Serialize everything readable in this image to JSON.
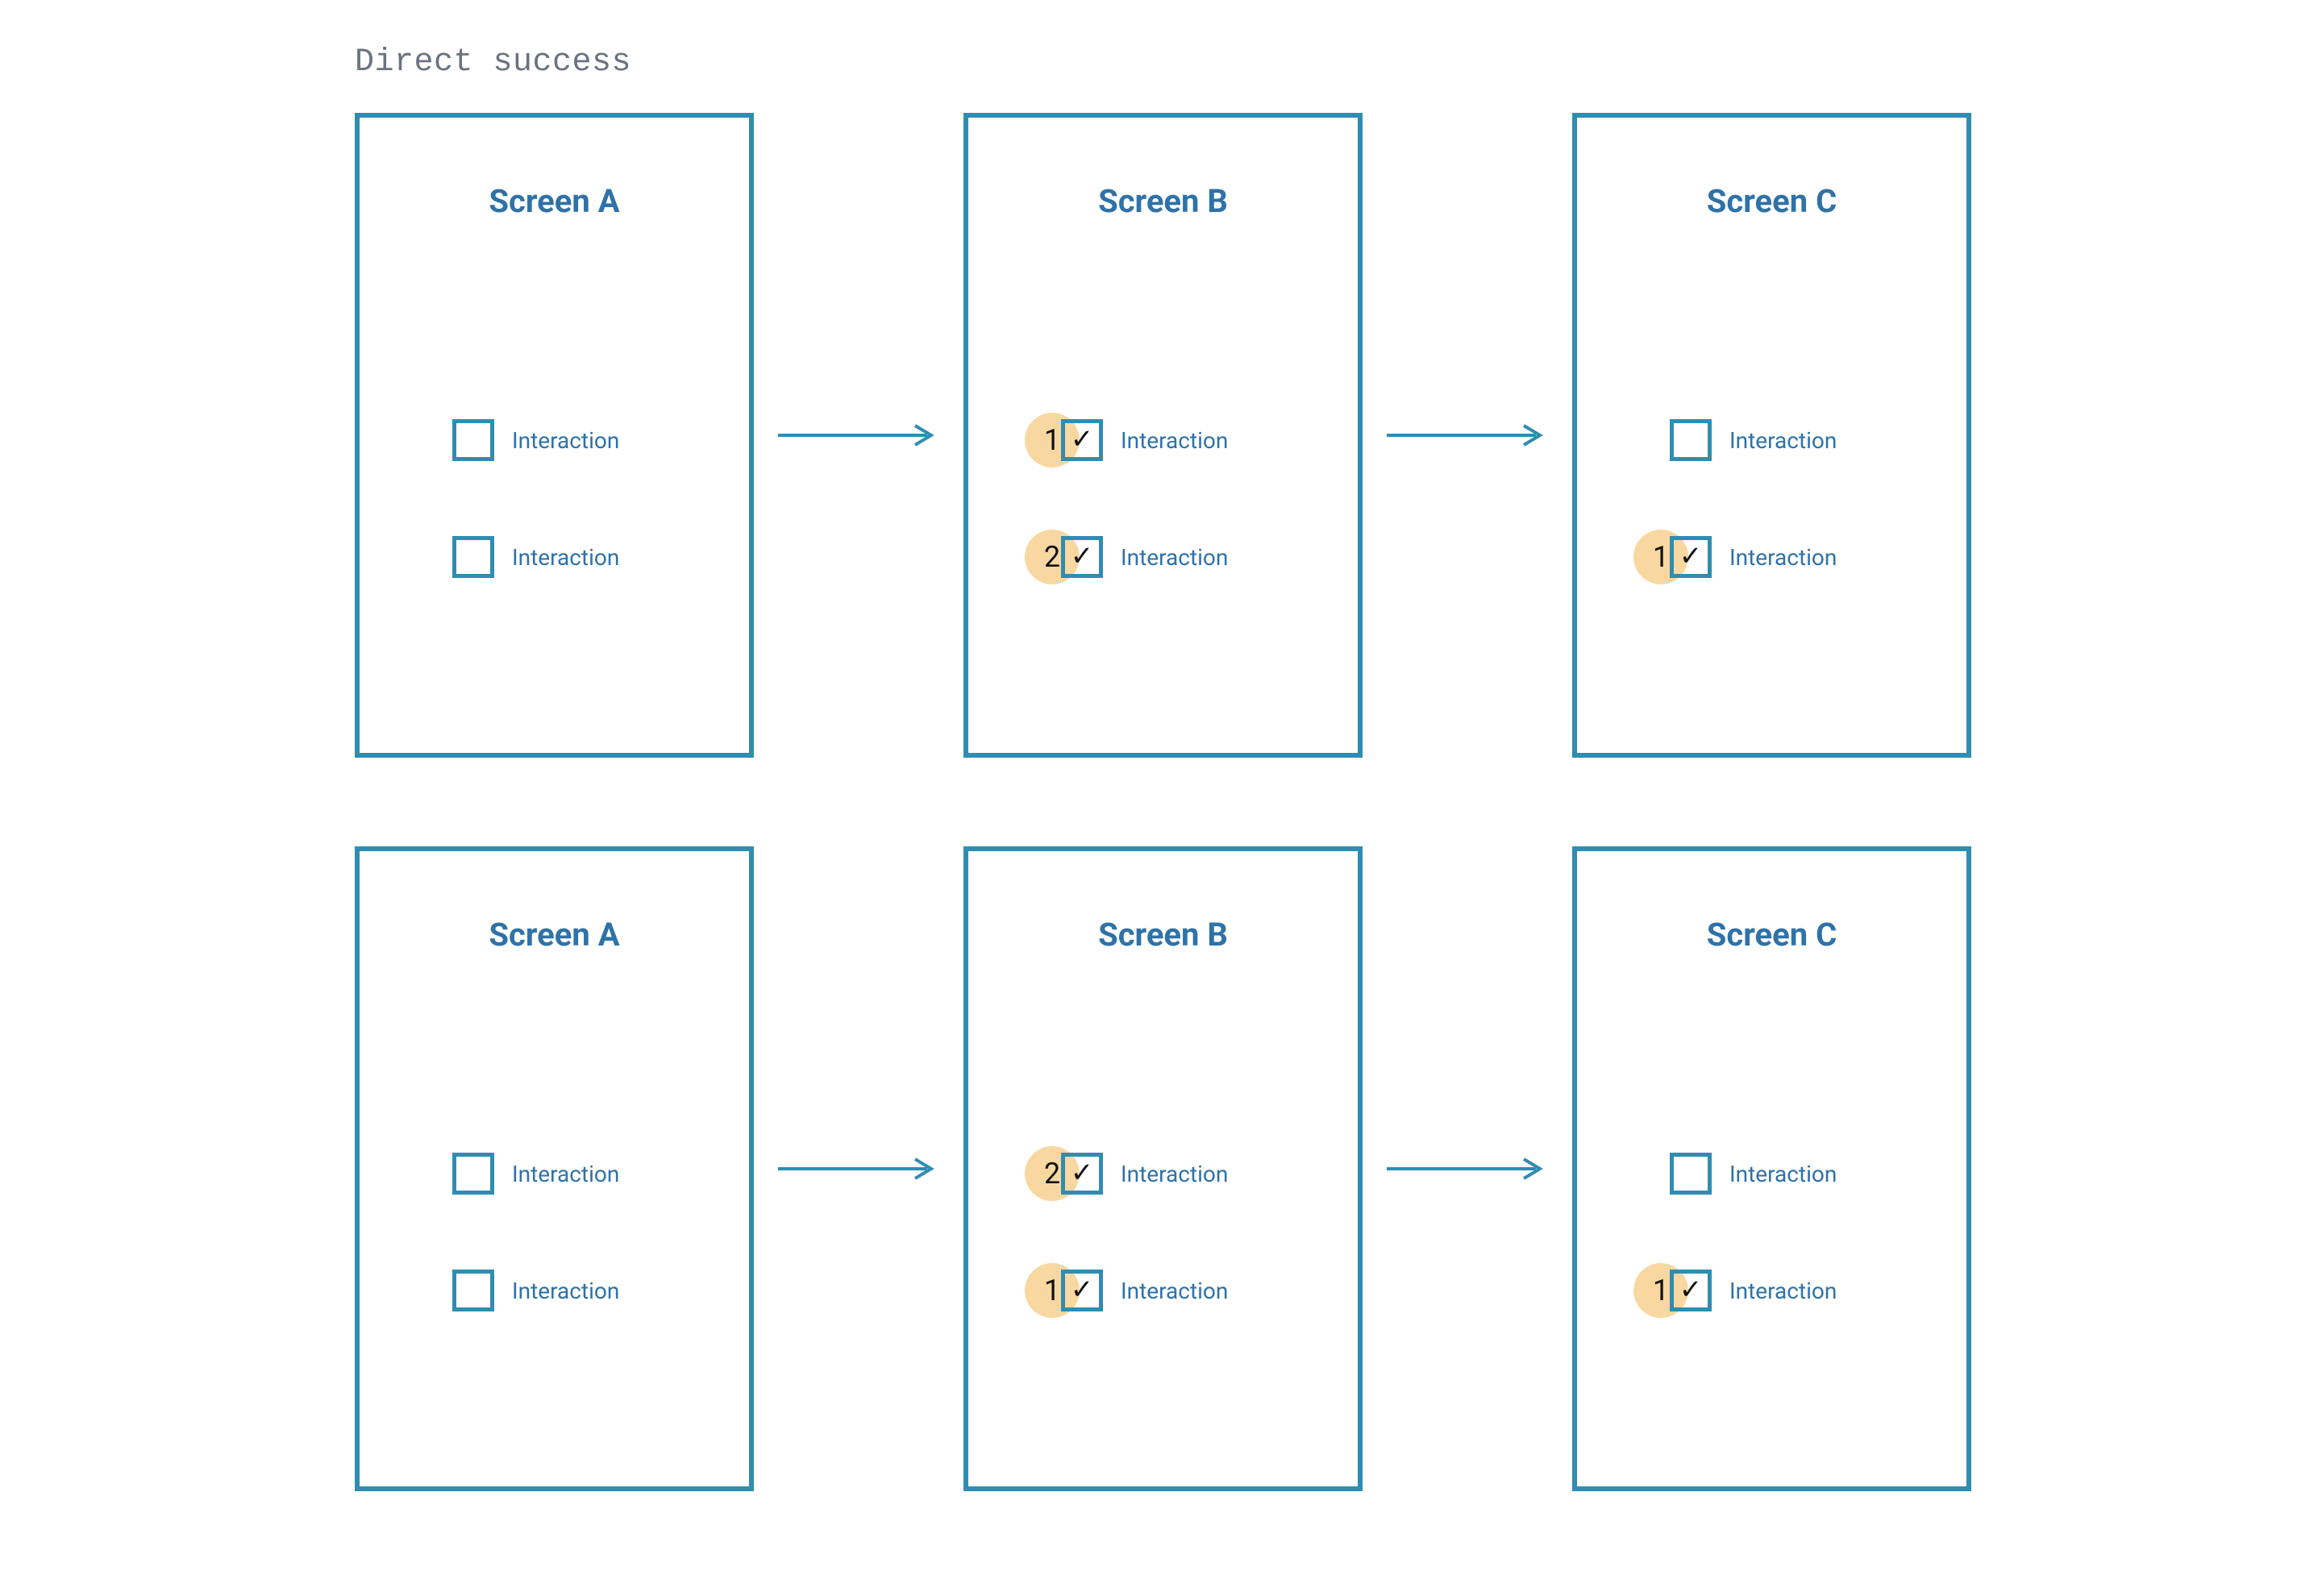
{
  "colors": {
    "stroke": "#2f8db1",
    "text_primary": "#2f72a8",
    "heading": "#6b7280",
    "badge_bg": "#f8d8a0",
    "badge_text": "#111111",
    "checkmark": "#111111"
  },
  "heading": "Direct success",
  "flows": [
    {
      "id": "flow-1",
      "screens": [
        {
          "title": "Screen A",
          "interactions": [
            {
              "label": "Interaction",
              "checked": false,
              "step_badge": null
            },
            {
              "label": "Interaction",
              "checked": false,
              "step_badge": null
            }
          ]
        },
        {
          "title": "Screen B",
          "interactions": [
            {
              "label": "Interaction",
              "checked": true,
              "step_badge": "1"
            },
            {
              "label": "Interaction",
              "checked": true,
              "step_badge": "2"
            }
          ]
        },
        {
          "title": "Screen C",
          "interactions": [
            {
              "label": "Interaction",
              "checked": false,
              "step_badge": null
            },
            {
              "label": "Interaction",
              "checked": true,
              "step_badge": "1"
            }
          ]
        }
      ]
    },
    {
      "id": "flow-2",
      "screens": [
        {
          "title": "Screen A",
          "interactions": [
            {
              "label": "Interaction",
              "checked": false,
              "step_badge": null
            },
            {
              "label": "Interaction",
              "checked": false,
              "step_badge": null
            }
          ]
        },
        {
          "title": "Screen B",
          "interactions": [
            {
              "label": "Interaction",
              "checked": true,
              "step_badge": "2"
            },
            {
              "label": "Interaction",
              "checked": true,
              "step_badge": "1"
            }
          ]
        },
        {
          "title": "Screen C",
          "interactions": [
            {
              "label": "Interaction",
              "checked": false,
              "step_badge": null
            },
            {
              "label": "Interaction",
              "checked": true,
              "step_badge": "1"
            }
          ]
        }
      ]
    }
  ]
}
